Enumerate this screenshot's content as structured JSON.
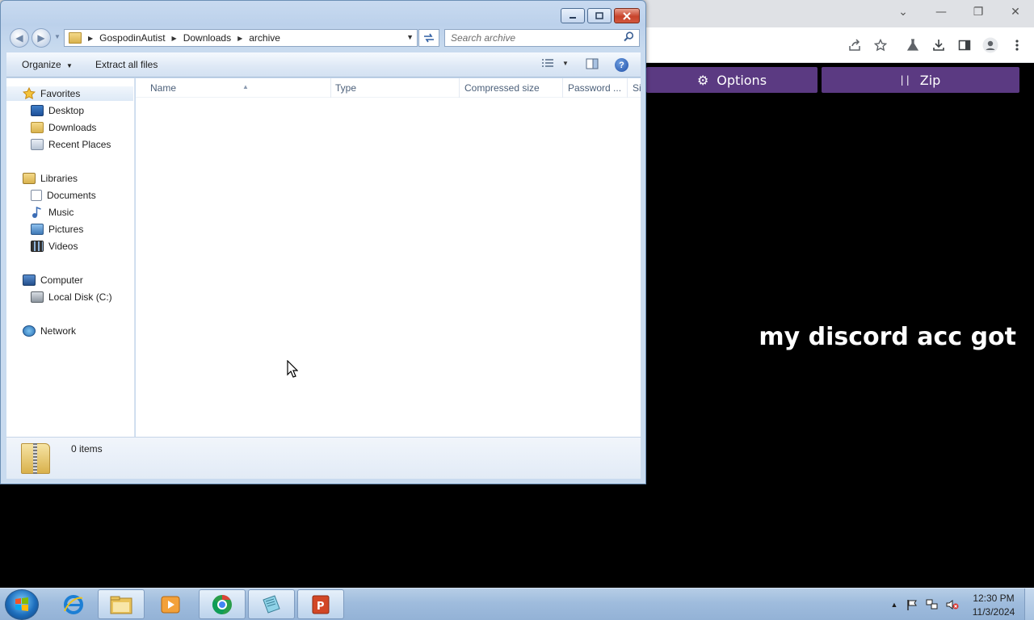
{
  "browser": {
    "controls": {
      "minimize": "—",
      "restore": "❐",
      "close": "✕",
      "tabs_menu": "⌄"
    },
    "toolbar_icons": [
      "share-icon",
      "star-icon",
      "lab-icon",
      "download-icon",
      "sidebar-icon",
      "profile-icon",
      "menu-icon"
    ],
    "page": {
      "options_label": "Options",
      "zip_label": "Zip",
      "headline": "my discord acc got",
      "accent_color": "#5b3a82"
    }
  },
  "explorer": {
    "breadcrumbs": [
      "GospodinAutist",
      "Downloads",
      "archive"
    ],
    "search_placeholder": "Search archive",
    "commands": {
      "organize": "Organize",
      "extract_all": "Extract all files"
    },
    "navigation": {
      "favorites": {
        "label": "Favorites",
        "items": [
          "Desktop",
          "Downloads",
          "Recent Places"
        ]
      },
      "libraries": {
        "label": "Libraries",
        "items": [
          "Documents",
          "Music",
          "Pictures",
          "Videos"
        ]
      },
      "computer": {
        "label": "Computer",
        "items": [
          "Local Disk (C:)"
        ]
      },
      "network": {
        "label": "Network"
      }
    },
    "columns": [
      "Name",
      "Type",
      "Compressed size",
      "Password ...",
      "Si"
    ],
    "details": {
      "item_count": "0 items"
    }
  },
  "taskbar": {
    "apps": [
      "internet-explorer-icon",
      "windows-explorer-icon",
      "media-player-icon",
      "chrome-icon",
      "notepad-icon",
      "powerpoint-icon"
    ],
    "clock": {
      "time": "12:30 PM",
      "date": "11/3/2024"
    }
  }
}
